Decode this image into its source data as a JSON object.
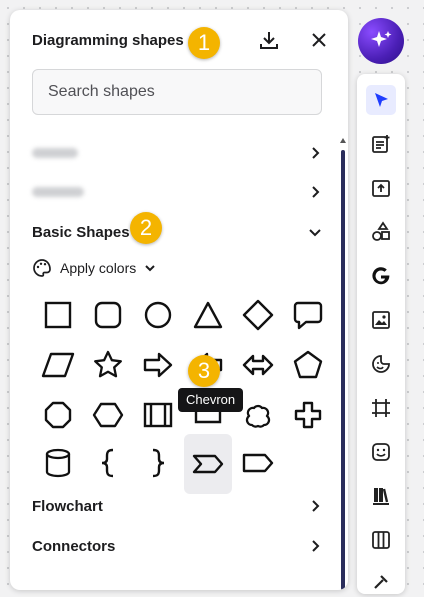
{
  "panel": {
    "title": "Diagramming shapes",
    "search_placeholder": "Search shapes",
    "categories": [
      {
        "label": "Flowchart"
      },
      {
        "label": "Connectors"
      }
    ],
    "basic_shapes": {
      "label": "Basic Shapes",
      "apply_colors": "Apply colors"
    },
    "tooltip": "Chevron"
  },
  "badges": [
    "1",
    "2",
    "3"
  ],
  "colors": {
    "badge": "#f4b400",
    "accent": "#3d5afe",
    "thumb": "#2a2d5b"
  }
}
